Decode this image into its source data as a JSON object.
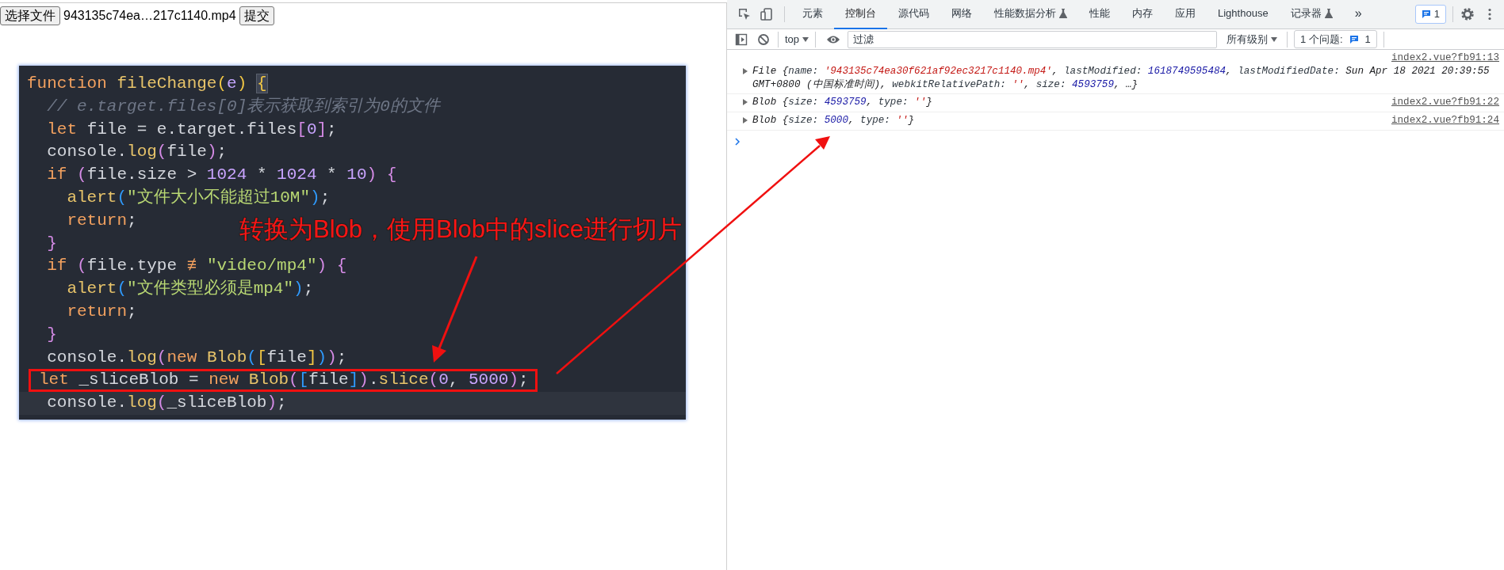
{
  "file_form": {
    "choose_button": "选择文件",
    "file_name": "943135c74ea…217c1140.mp4",
    "submit_button": "提交"
  },
  "code_editor": {
    "lines": [
      {
        "current": false,
        "boxed": false,
        "tokens": [
          {
            "text": "function ",
            "kind": "kw"
          },
          {
            "text": "fileChange",
            "kind": "fn"
          },
          {
            "text": "(",
            "kind": "pa"
          },
          {
            "text": "e",
            "kind": "param"
          },
          {
            "text": ") ",
            "kind": "pa"
          },
          {
            "text": "{",
            "kind": "match"
          }
        ]
      },
      {
        "current": false,
        "boxed": false,
        "tokens": [
          {
            "text": "  // e.target.files[0]表示获取到索引为0的文件",
            "kind": "cm"
          }
        ]
      },
      {
        "current": false,
        "boxed": false,
        "tokens": [
          {
            "text": "  let ",
            "kind": "kw"
          },
          {
            "text": "file = e.target.files",
            "kind": "id"
          },
          {
            "text": "[",
            "kind": "pb"
          },
          {
            "text": "0",
            "kind": "num"
          },
          {
            "text": "]",
            "kind": "pb"
          },
          {
            "text": ";",
            "kind": "id"
          }
        ]
      },
      {
        "current": false,
        "boxed": false,
        "tokens": [
          {
            "text": "  console.",
            "kind": "id"
          },
          {
            "text": "log",
            "kind": "fn"
          },
          {
            "text": "(",
            "kind": "pb"
          },
          {
            "text": "file",
            "kind": "id"
          },
          {
            "text": ")",
            "kind": "pb"
          },
          {
            "text": ";",
            "kind": "id"
          }
        ]
      },
      {
        "current": false,
        "boxed": false,
        "tokens": [
          {
            "text": "  if ",
            "kind": "kw"
          },
          {
            "text": "(",
            "kind": "pb"
          },
          {
            "text": "file.size > ",
            "kind": "id"
          },
          {
            "text": "1024",
            "kind": "num"
          },
          {
            "text": " * ",
            "kind": "id"
          },
          {
            "text": "1024",
            "kind": "num"
          },
          {
            "text": " * ",
            "kind": "id"
          },
          {
            "text": "10",
            "kind": "num"
          },
          {
            "text": ") ",
            "kind": "pb"
          },
          {
            "text": "{",
            "kind": "pb"
          }
        ]
      },
      {
        "current": false,
        "boxed": false,
        "tokens": [
          {
            "text": "    alert",
            "kind": "fn"
          },
          {
            "text": "(",
            "kind": "pc"
          },
          {
            "text": "\"文件大小不能超过10M\"",
            "kind": "str"
          },
          {
            "text": ")",
            "kind": "pc"
          },
          {
            "text": ";",
            "kind": "id"
          }
        ]
      },
      {
        "current": false,
        "boxed": false,
        "tokens": [
          {
            "text": "    return",
            "kind": "kw"
          },
          {
            "text": ";",
            "kind": "id"
          }
        ]
      },
      {
        "current": false,
        "boxed": false,
        "tokens": [
          {
            "text": "  }",
            "kind": "pb"
          }
        ]
      },
      {
        "current": false,
        "boxed": false,
        "tokens": [
          {
            "text": "  if ",
            "kind": "kw"
          },
          {
            "text": "(",
            "kind": "pb"
          },
          {
            "text": "file.type ",
            "kind": "id"
          },
          {
            "text": "≢ ",
            "kind": "op"
          },
          {
            "text": "\"video/mp4\"",
            "kind": "str"
          },
          {
            "text": ") ",
            "kind": "pb"
          },
          {
            "text": "{",
            "kind": "pb"
          }
        ]
      },
      {
        "current": false,
        "boxed": false,
        "tokens": [
          {
            "text": "    alert",
            "kind": "fn"
          },
          {
            "text": "(",
            "kind": "pc"
          },
          {
            "text": "\"文件类型必须是mp4\"",
            "kind": "str"
          },
          {
            "text": ")",
            "kind": "pc"
          },
          {
            "text": ";",
            "kind": "id"
          }
        ]
      },
      {
        "current": false,
        "boxed": false,
        "tokens": [
          {
            "text": "    return",
            "kind": "kw"
          },
          {
            "text": ";",
            "kind": "id"
          }
        ]
      },
      {
        "current": false,
        "boxed": false,
        "tokens": [
          {
            "text": "  }",
            "kind": "pb"
          }
        ]
      },
      {
        "current": false,
        "boxed": false,
        "tokens": [
          {
            "text": "  console.",
            "kind": "id"
          },
          {
            "text": "log",
            "kind": "fn"
          },
          {
            "text": "(",
            "kind": "pb"
          },
          {
            "text": "new ",
            "kind": "kw"
          },
          {
            "text": "Blob",
            "kind": "fn"
          },
          {
            "text": "(",
            "kind": "pc"
          },
          {
            "text": "[",
            "kind": "pa"
          },
          {
            "text": "file",
            "kind": "id"
          },
          {
            "text": "]",
            "kind": "pa"
          },
          {
            "text": ")",
            "kind": "pc"
          },
          {
            "text": ")",
            "kind": "pb"
          },
          {
            "text": ";",
            "kind": "id"
          }
        ]
      },
      {
        "current": false,
        "boxed": true,
        "tokens": [
          {
            "text": "let ",
            "kind": "kw"
          },
          {
            "text": "_sliceBlob = ",
            "kind": "id"
          },
          {
            "text": "new ",
            "kind": "kw"
          },
          {
            "text": "Blob",
            "kind": "fn"
          },
          {
            "text": "(",
            "kind": "pb"
          },
          {
            "text": "[",
            "kind": "pc"
          },
          {
            "text": "file",
            "kind": "id"
          },
          {
            "text": "]",
            "kind": "pc"
          },
          {
            "text": ")",
            "kind": "pb"
          },
          {
            "text": ".",
            "kind": "id"
          },
          {
            "text": "slice",
            "kind": "fn"
          },
          {
            "text": "(",
            "kind": "pb"
          },
          {
            "text": "0",
            "kind": "num"
          },
          {
            "text": ", ",
            "kind": "id"
          },
          {
            "text": "5000",
            "kind": "num"
          },
          {
            "text": ")",
            "kind": "pb"
          },
          {
            "text": ";",
            "kind": "id"
          }
        ]
      },
      {
        "current": true,
        "boxed": false,
        "tokens": [
          {
            "text": "  console.",
            "kind": "id"
          },
          {
            "text": "log",
            "kind": "fn"
          },
          {
            "text": "(",
            "kind": "pb"
          },
          {
            "text": "_sliceBlob",
            "kind": "id"
          },
          {
            "text": ")",
            "kind": "pb"
          },
          {
            "text": ";",
            "kind": "id"
          }
        ]
      }
    ]
  },
  "annotation": "转换为Blob，使用Blob中的slice进行切片",
  "devtools": {
    "tabs": [
      {
        "label": "元素",
        "selected": false,
        "experimental": false
      },
      {
        "label": "控制台",
        "selected": true,
        "experimental": false
      },
      {
        "label": "源代码",
        "selected": false,
        "experimental": false
      },
      {
        "label": "网络",
        "selected": false,
        "experimental": false
      },
      {
        "label": "性能数据分析",
        "selected": false,
        "experimental": true
      },
      {
        "label": "性能",
        "selected": false,
        "experimental": false
      },
      {
        "label": "内存",
        "selected": false,
        "experimental": false
      },
      {
        "label": "应用",
        "selected": false,
        "experimental": false
      },
      {
        "label": "Lighthouse",
        "selected": false,
        "experimental": false
      },
      {
        "label": "记录器",
        "selected": false,
        "experimental": true
      }
    ],
    "more_tabs": "»",
    "issues_count": "1",
    "console_toolbar": {
      "context": "top",
      "filter_placeholder": "过滤",
      "levels": "所有级别",
      "issues_label": "1 个问题:",
      "issues_count": "1"
    },
    "messages": [
      {
        "expandable": true,
        "source": "index2.vue?fb91:13",
        "tokens": [
          {
            "text": "File {",
            "kind": "plain"
          },
          {
            "text": "name: ",
            "kind": "key"
          },
          {
            "text": "'943135c74ea30f621af92ec3217c1140.mp4'",
            "kind": "str"
          },
          {
            "text": ", ",
            "kind": "plain"
          },
          {
            "text": "lastModified: ",
            "kind": "key"
          },
          {
            "text": "1618749595484",
            "kind": "num"
          },
          {
            "text": ", ",
            "kind": "plain"
          },
          {
            "text": "lastModifiedDate: ",
            "kind": "key"
          },
          {
            "text": "Sun Apr 18 2021 20:39:55 GMT+0800 (中国标准时间)",
            "kind": "plain"
          },
          {
            "text": ", ",
            "kind": "plain"
          },
          {
            "text": "webkitRelativePath: ",
            "kind": "key"
          },
          {
            "text": "''",
            "kind": "str"
          },
          {
            "text": ", ",
            "kind": "plain"
          },
          {
            "text": "size: ",
            "kind": "key"
          },
          {
            "text": "4593759",
            "kind": "num"
          },
          {
            "text": ", …}",
            "kind": "plain"
          }
        ]
      },
      {
        "expandable": true,
        "source": "index2.vue?fb91:22",
        "tokens": [
          {
            "text": "Blob {",
            "kind": "plain"
          },
          {
            "text": "size: ",
            "kind": "key"
          },
          {
            "text": "4593759",
            "kind": "num"
          },
          {
            "text": ", ",
            "kind": "plain"
          },
          {
            "text": "type: ",
            "kind": "key"
          },
          {
            "text": "''",
            "kind": "str"
          },
          {
            "text": "}",
            "kind": "plain"
          }
        ]
      },
      {
        "expandable": true,
        "source": "index2.vue?fb91:24",
        "tokens": [
          {
            "text": "Blob {",
            "kind": "plain"
          },
          {
            "text": "size: ",
            "kind": "key"
          },
          {
            "text": "5000",
            "kind": "num"
          },
          {
            "text": ", ",
            "kind": "plain"
          },
          {
            "text": "type: ",
            "kind": "key"
          },
          {
            "text": "''",
            "kind": "str"
          },
          {
            "text": "}",
            "kind": "plain"
          }
        ]
      }
    ]
  }
}
